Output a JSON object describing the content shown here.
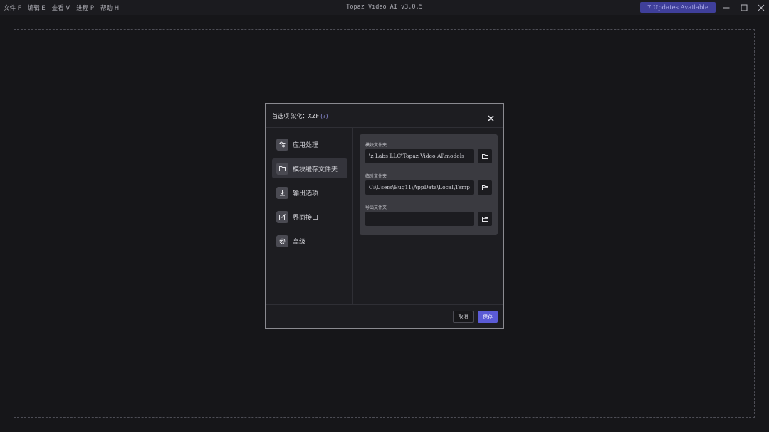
{
  "menubar": {
    "items": [
      {
        "label": "文件 F"
      },
      {
        "label": "编辑 E"
      },
      {
        "label": "查看 V"
      },
      {
        "label": "进程 P"
      },
      {
        "label": "帮助 H"
      }
    ]
  },
  "app": {
    "title": "Topaz Video AI  v3.0.5",
    "update_label": "7 Updates Available"
  },
  "dialog": {
    "title": "首选项 汉化：XZF",
    "help": "(?)",
    "nav": [
      {
        "label": "应用处理",
        "icon": "sliders-icon"
      },
      {
        "label": "模块缓存文件夹",
        "icon": "folder-icon"
      },
      {
        "label": "输出选项",
        "icon": "download-icon"
      },
      {
        "label": "界面接口",
        "icon": "edit-icon"
      },
      {
        "label": "高级",
        "icon": "gear-icon"
      }
    ],
    "active_nav": "模块缓存文件夹",
    "fields": {
      "model_folder": {
        "label": "模块文件夹",
        "value": "z Labs LLC\\Topaz Video AI\\models\\"
      },
      "temp_folder": {
        "label": "临时文件夹",
        "value": "C:\\Users\\Bug11\\AppData\\Local\\Temp"
      },
      "export_folder": {
        "label": "导出文件夹",
        "value": "."
      }
    },
    "cancel_label": "取消",
    "save_label": "保存"
  },
  "colors": {
    "background": "#161619",
    "accent": "#5b5bd6",
    "update_badge": "#3f3f9a"
  }
}
